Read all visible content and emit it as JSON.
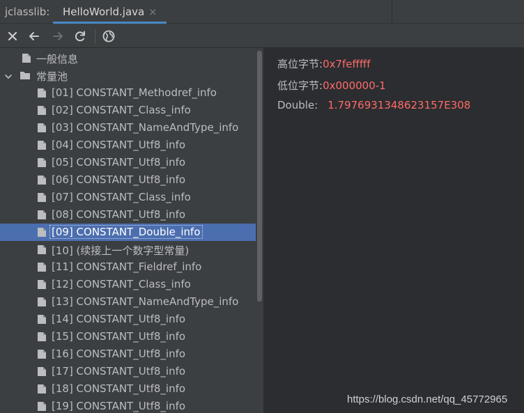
{
  "tabbar": {
    "tool_title": "jclasslib:",
    "file_tab": "HelloWorld.java",
    "close_glyph": "×"
  },
  "toolbar": {
    "icons": [
      "close-icon",
      "back-icon",
      "forward-icon",
      "refresh-icon",
      "globe-icon"
    ]
  },
  "tree": {
    "general_info": "一般信息",
    "constant_pool": "常量池",
    "entries": [
      "[01] CONSTANT_Methodref_info",
      "[02] CONSTANT_Class_info",
      "[03] CONSTANT_NameAndType_info",
      "[04] CONSTANT_Utf8_info",
      "[05] CONSTANT_Utf8_info",
      "[06] CONSTANT_Utf8_info",
      "[07] CONSTANT_Class_info",
      "[08] CONSTANT_Utf8_info",
      "[09] CONSTANT_Double_info",
      "[10] (续接上一个数字型常量)",
      "[11] CONSTANT_Fieldref_info",
      "[12] CONSTANT_Class_info",
      "[13] CONSTANT_NameAndType_info",
      "[14] CONSTANT_Utf8_info",
      "[15] CONSTANT_Utf8_info",
      "[16] CONSTANT_Utf8_info",
      "[17] CONSTANT_Utf8_info",
      "[18] CONSTANT_Utf8_info",
      "[19] CONSTANT_Utf8_info"
    ],
    "selected": "[09] CONSTANT_Double_info"
  },
  "details": {
    "high_bytes_label": "高位字节:",
    "high_bytes_value": "0x7fefffff",
    "low_bytes_label": "低位字节:",
    "low_bytes_value": "0x000000-1",
    "double_label": "Double:",
    "double_value": "1.7976931348623157E308"
  },
  "watermark": "https://blog.csdn.net/qq_45772965",
  "colors": {
    "accent": "#4a88c7",
    "selection": "#4b6eaf",
    "value": "#ff6b68"
  }
}
